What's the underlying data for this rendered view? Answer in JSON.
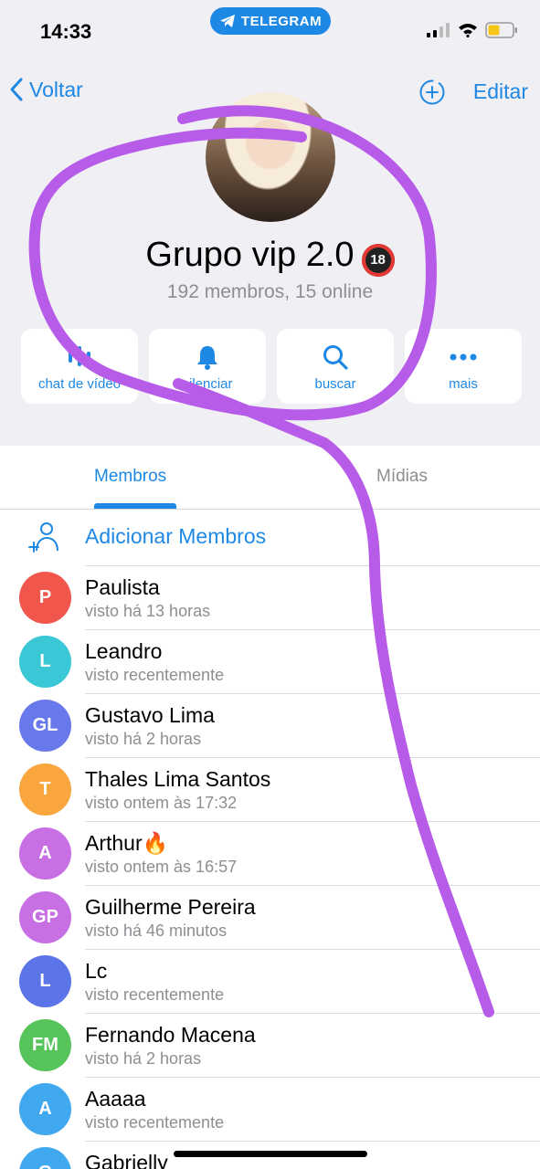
{
  "status": {
    "time": "14:33",
    "app_pill": "TELEGRAM"
  },
  "nav": {
    "back_label": "Voltar",
    "edit_label": "Editar"
  },
  "group": {
    "title": "Grupo vip 2.0",
    "badge": "18",
    "subtitle": "192 membros, 15 online"
  },
  "actions": [
    {
      "label": "chat de vídeo",
      "icon": "video-chat-icon"
    },
    {
      "label": "silenciar",
      "icon": "bell-icon"
    },
    {
      "label": "buscar",
      "icon": "search-icon"
    },
    {
      "label": "mais",
      "icon": "more-icon"
    }
  ],
  "tabs": {
    "active": "Membros",
    "inactive": "Mídias"
  },
  "add_members": {
    "label": "Adicionar Membros"
  },
  "members": [
    {
      "initials": "P",
      "first": "Paulista",
      "rest": "",
      "seen": "visto há 13 horas",
      "color": "#f0564b"
    },
    {
      "initials": "L",
      "first": "Leandro",
      "rest": "",
      "seen": "visto recentemente",
      "color": "#3ac7d6"
    },
    {
      "initials": "GL",
      "first": "Gustavo",
      "rest": " Lima",
      "seen": "visto há 2 horas",
      "color": "#6879ec"
    },
    {
      "initials": "T",
      "first": "Thales Lima Santos",
      "rest": "",
      "seen": "visto ontem às 17:32",
      "color": "#f8a63d"
    },
    {
      "initials": "A",
      "first": "Arthur",
      "rest": "🔥",
      "seen": "visto ontem às 16:57",
      "color": "#c76fe3"
    },
    {
      "initials": "GP",
      "first": "Guilherme",
      "rest": " Pereira",
      "seen": "visto há 46 minutos",
      "color": "#c76fe3"
    },
    {
      "initials": "L",
      "first": "Lc",
      "rest": "",
      "seen": "visto recentemente",
      "color": "#5b74e8"
    },
    {
      "initials": "FM",
      "first": "Fernando",
      "rest": " Macena",
      "seen": "visto há 2 horas",
      "color": "#56c45a"
    },
    {
      "initials": "A",
      "first": "Aaaaa",
      "rest": "",
      "seen": "visto recentemente",
      "color": "#3fa8ee"
    },
    {
      "initials": "G",
      "first": "Gabrielly",
      "rest": "",
      "seen": "",
      "color": "#3fa8ee"
    }
  ],
  "colors": {
    "accent": "#1e88e5",
    "scribble": "#b65ce8"
  }
}
